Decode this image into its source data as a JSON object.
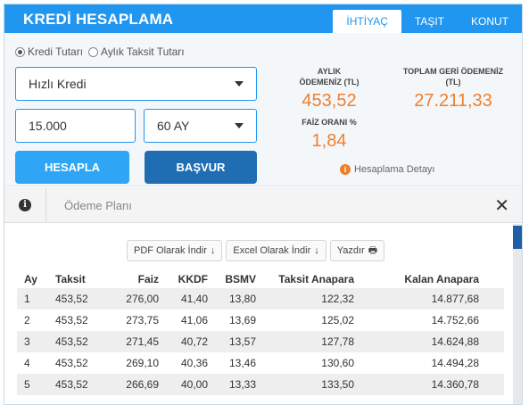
{
  "header": {
    "title": "KREDİ HESAPLAMA",
    "tabs": [
      {
        "label": "İHTİYAÇ",
        "active": true
      },
      {
        "label": "TAŞIT",
        "active": false
      },
      {
        "label": "KONUT",
        "active": false
      }
    ]
  },
  "calculator": {
    "radio_options": [
      {
        "label": "Kredi Tutarı",
        "selected": true
      },
      {
        "label": "Aylık Taksit Tutarı",
        "selected": false
      }
    ],
    "loan_type": "Hızlı Kredi",
    "amount": "15.000",
    "term": "60 AY",
    "calculate_label": "HESAPLA",
    "apply_label": "BAŞVUR"
  },
  "results": {
    "monthly_label_1": "AYLIK",
    "monthly_label_2": "ÖDEMENİZ (TL)",
    "monthly_value": "453,52",
    "total_label_1": "TOPLAM GERİ ÖDEMENİZ",
    "total_label_2": "(TL)",
    "total_value": "27.211,33",
    "rate_label": "FAİZ ORANI %",
    "rate_value": "1,84",
    "detail_link": "Hesaplama Detayı"
  },
  "plan": {
    "title": "Ödeme Planı",
    "exports": [
      {
        "label": "PDF Olarak İndir",
        "icon": "download-arrow-icon",
        "glyph": "↓"
      },
      {
        "label": "Excel Olarak İndir",
        "icon": "download-arrow-icon",
        "glyph": "↓"
      },
      {
        "label": "Yazdır",
        "icon": "printer-icon",
        "glyph": "🖶"
      }
    ],
    "columns": [
      "Ay",
      "Taksit",
      "Faiz",
      "KKDF",
      "BSMV",
      "Taksit Anapara",
      "Kalan Anapara"
    ],
    "rows": [
      [
        "1",
        "453,52",
        "276,00",
        "41,40",
        "13,80",
        "122,32",
        "14.877,68"
      ],
      [
        "2",
        "453,52",
        "273,75",
        "41,06",
        "13,69",
        "125,02",
        "14.752,66"
      ],
      [
        "3",
        "453,52",
        "271,45",
        "40,72",
        "13,57",
        "127,78",
        "14.624,88"
      ],
      [
        "4",
        "453,52",
        "269,10",
        "40,36",
        "13,46",
        "130,60",
        "14.494,28"
      ],
      [
        "5",
        "453,52",
        "266,69",
        "40,00",
        "13,33",
        "133,50",
        "14.360,78"
      ]
    ]
  },
  "colors": {
    "primary": "#2196f0",
    "apply": "#1f6eb4",
    "accent": "#f07f2d"
  }
}
